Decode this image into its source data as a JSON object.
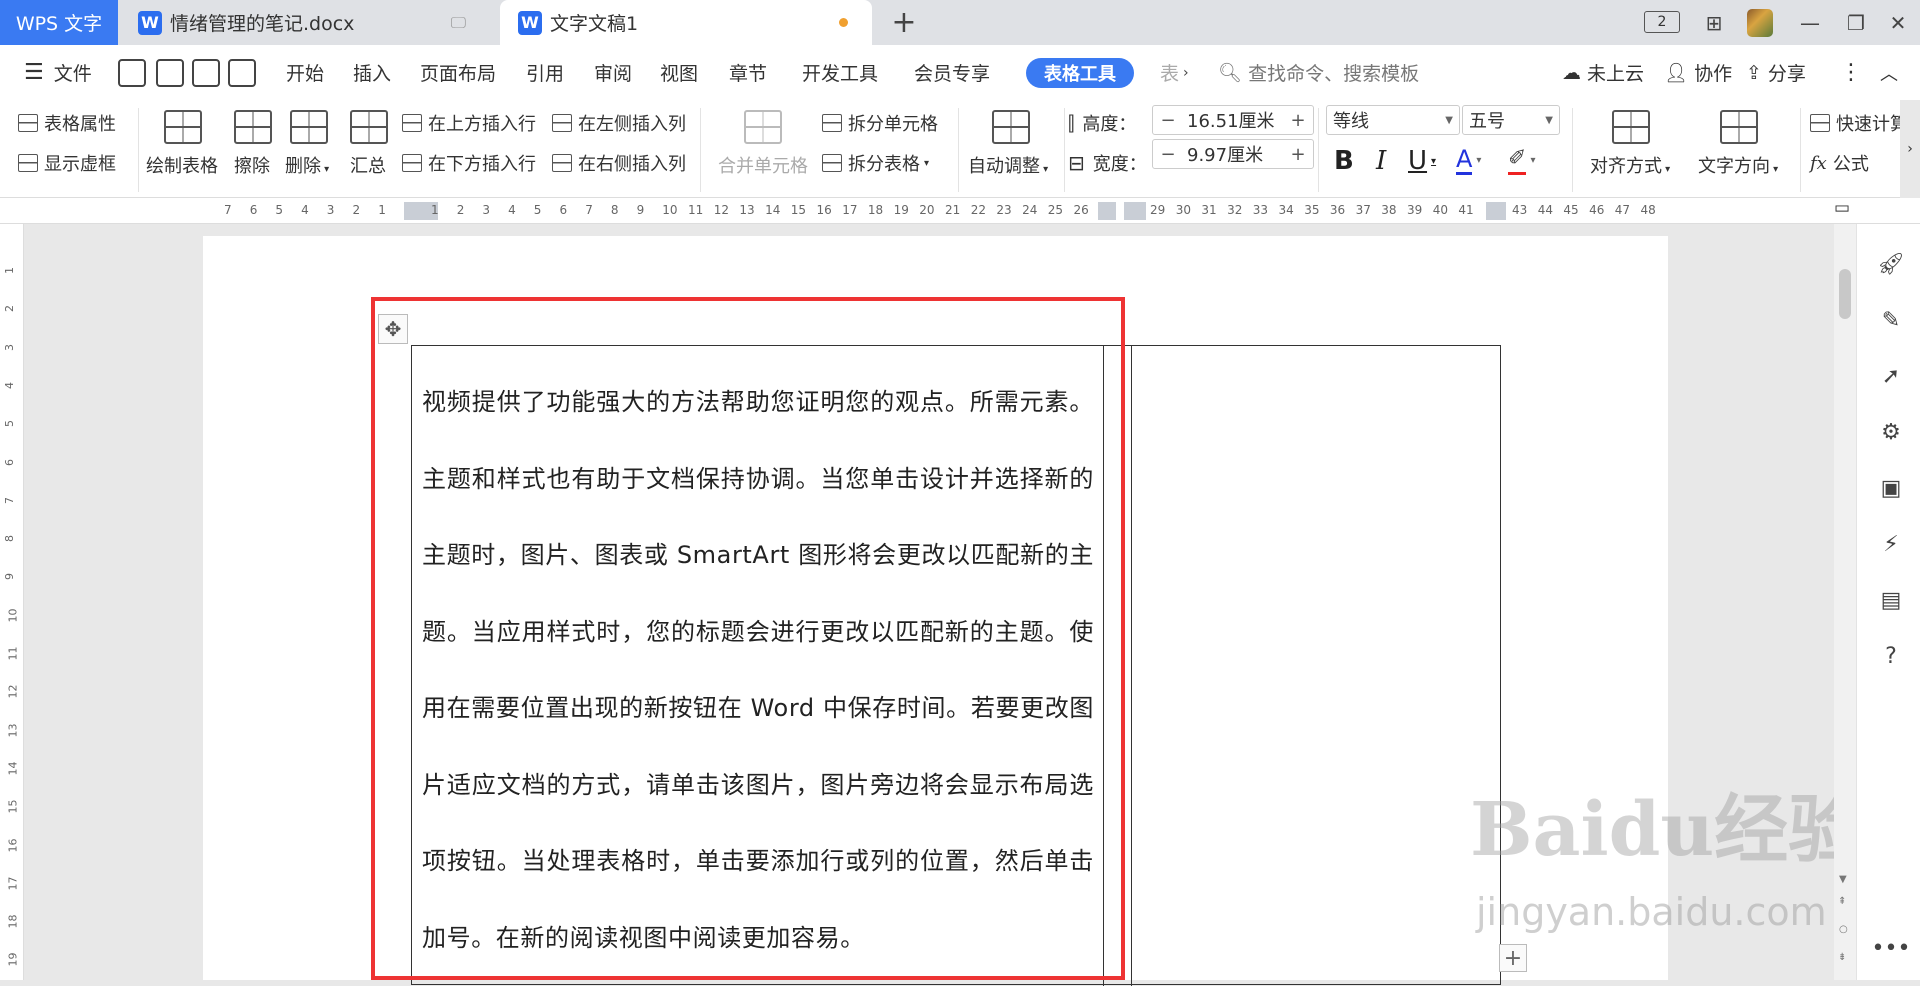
{
  "tabs": {
    "app": "WPS 文字",
    "doc1": "情绪管理的笔记.docx",
    "doc2": "文字文稿1",
    "new": "+",
    "badge": "2"
  },
  "menu": {
    "file": "文件",
    "items": [
      "开始",
      "插入",
      "页面布局",
      "引用",
      "审阅",
      "视图",
      "章节",
      "开发工具",
      "会员专享"
    ],
    "active": "表格工具",
    "overflow": "表",
    "search": "查找命令、搜索模板",
    "cloud": "未上云",
    "collab": "协作",
    "share": "分享"
  },
  "ribbon": {
    "table_props": "表格属性",
    "show_grid": "显示虚框",
    "draw_table": "绘制表格",
    "erase": "擦除",
    "delete": "删除",
    "summary": "汇总",
    "insert_above": "在上方插入行",
    "insert_below": "在下方插入行",
    "insert_left": "在左侧插入列",
    "insert_right": "在右侧插入列",
    "merge_cells": "合并单元格",
    "split_cells": "拆分单元格",
    "split_table": "拆分表格",
    "auto_fit": "自动调整",
    "height_label": "高度：",
    "height_value": "16.51厘米",
    "width_label": "宽度：",
    "width_value": "9.97厘米",
    "font_name": "等线",
    "font_size": "五号",
    "align": "对齐方式",
    "text_dir": "文字方向",
    "quick_calc": "快速计算",
    "formula": "公式",
    "bold": "B",
    "italic": "I",
    "underline": "U",
    "font_color": "A"
  },
  "ruler": {
    "left_nums": [
      "7",
      "6",
      "5",
      "4",
      "3",
      "2",
      "1"
    ],
    "right_nums": [
      "1",
      "2",
      "3",
      "4",
      "5",
      "6",
      "7",
      "8",
      "9",
      "10",
      "11",
      "12",
      "13",
      "14",
      "15",
      "16",
      "17",
      "18",
      "19",
      "20",
      "21",
      "22",
      "23",
      "24",
      "25",
      "26"
    ],
    "far_nums": [
      "29",
      "30",
      "31",
      "32",
      "33",
      "34",
      "35",
      "36",
      "37",
      "38",
      "39",
      "40",
      "41"
    ],
    "end_nums": [
      "43",
      "44",
      "45",
      "46",
      "47",
      "48"
    ],
    "vertical": [
      "1",
      "2",
      "3",
      "4",
      "5",
      "6",
      "7",
      "8",
      "9",
      "10",
      "11",
      "12",
      "13",
      "14",
      "15",
      "16",
      "17",
      "18",
      "19"
    ]
  },
  "document": {
    "cell_text": "视频提供了功能强大的方法帮助您证明您的观点。所需元素。主题和样式也有助于文档保持协调。当您单击设计并选择新的主题时，图片、图表或 SmartArt 图形将会更改以匹配新的主题。当应用样式时，您的标题会进行更改以匹配新的主题。使用在需要位置出现的新按钮在 Word 中保存时间。若要更改图片适应文档的方式，请单击该图片，图片旁边将会显示布局选项按钮。当处理表格时，单击要添加行或列的位置，然后单击加号。在新的阅读视图中阅读更加容易。",
    "highlight_color": "#ee3333"
  },
  "watermark": {
    "brand": "Baidu经验",
    "url": "jingyan.baidu.com"
  },
  "colors": {
    "accent": "#3a7af2",
    "font_color_bar": "#2233dd",
    "highlight_bar": "#ee2222"
  }
}
